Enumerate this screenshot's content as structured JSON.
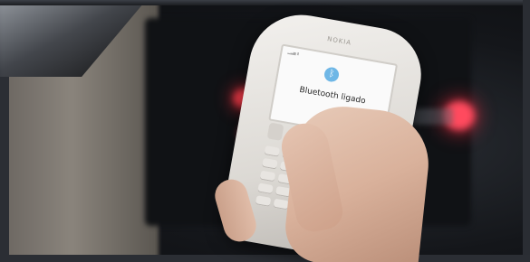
{
  "photo": {
    "phone_brand": "NOKIA",
    "screen_message": "Bluetooth ligado"
  },
  "icons": {
    "bluetooth": "bluetooth-icon"
  },
  "colors": {
    "indicator_red": "#ff3d4b",
    "bluetooth_blue": "#6fb7e6",
    "phone_body": "#efece8"
  }
}
